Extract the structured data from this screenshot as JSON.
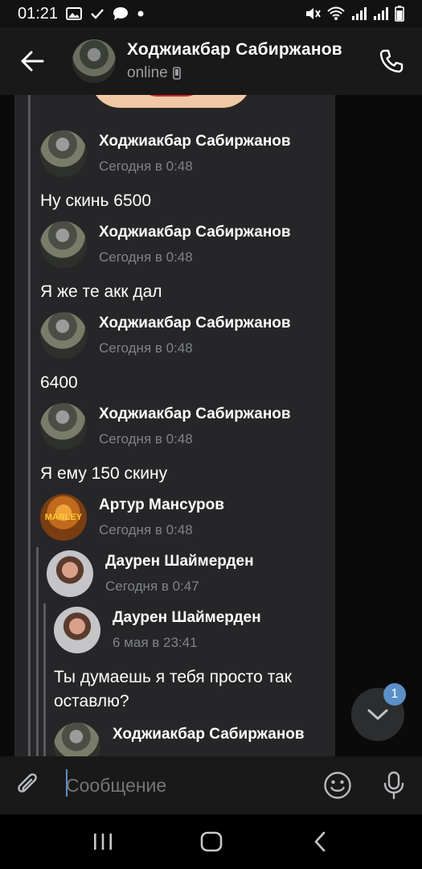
{
  "status_bar": {
    "time": "01:21",
    "left_icons": [
      "image-icon",
      "check-icon",
      "chat-bubble-icon",
      "dot-icon"
    ],
    "right_icons": [
      "mute-icon",
      "wifi-icon",
      "signal-icon",
      "signal-icon",
      "battery-icon"
    ]
  },
  "header": {
    "title": "Ходжиакбар Сабиржанов",
    "status": "online",
    "status_icon": "phone-device-icon",
    "back_icon": "arrow-left-icon",
    "call_icon": "phone-icon"
  },
  "messages": [
    {
      "author": "Ходжиакбар Сабиржанов",
      "time": "Сегодня в 0:48",
      "text": "Ну скинь 6500"
    },
    {
      "author": "Ходжиакбар Сабиржанов",
      "time": "Сегодня в 0:48",
      "text": "Я же те акк дал"
    },
    {
      "author": "Ходжиакбар Сабиржанов",
      "time": "Сегодня в 0:48",
      "text": "6400"
    },
    {
      "author": "Ходжиакбар Сабиржанов",
      "time": "Сегодня в 0:48",
      "text": "Я ему 150 скину"
    },
    {
      "author": "Артур Мансуров",
      "time": "Сегодня в 0:48",
      "avatar_text": "MARLEY"
    }
  ],
  "forwarded": [
    {
      "author": "Даурен Шаймерден",
      "time": "Сегодня в 0:47"
    },
    {
      "author": "Даурен Шаймерден",
      "time": "6 мая в 23:41",
      "text_line1": "Ты думаешь я тебя просто так",
      "text_line2": "оставлю?"
    },
    {
      "author": "Ходжиакбар Сабиржанов"
    }
  ],
  "scroll_button": {
    "badge": "1",
    "icon": "chevron-down-icon"
  },
  "composer": {
    "placeholder": "Сообщение",
    "attach_icon": "paperclip-icon",
    "emoji_icon": "smiley-icon",
    "mic_icon": "microphone-icon"
  },
  "navbar": {
    "icons": [
      "recent-apps-icon",
      "home-icon",
      "back-icon"
    ]
  }
}
